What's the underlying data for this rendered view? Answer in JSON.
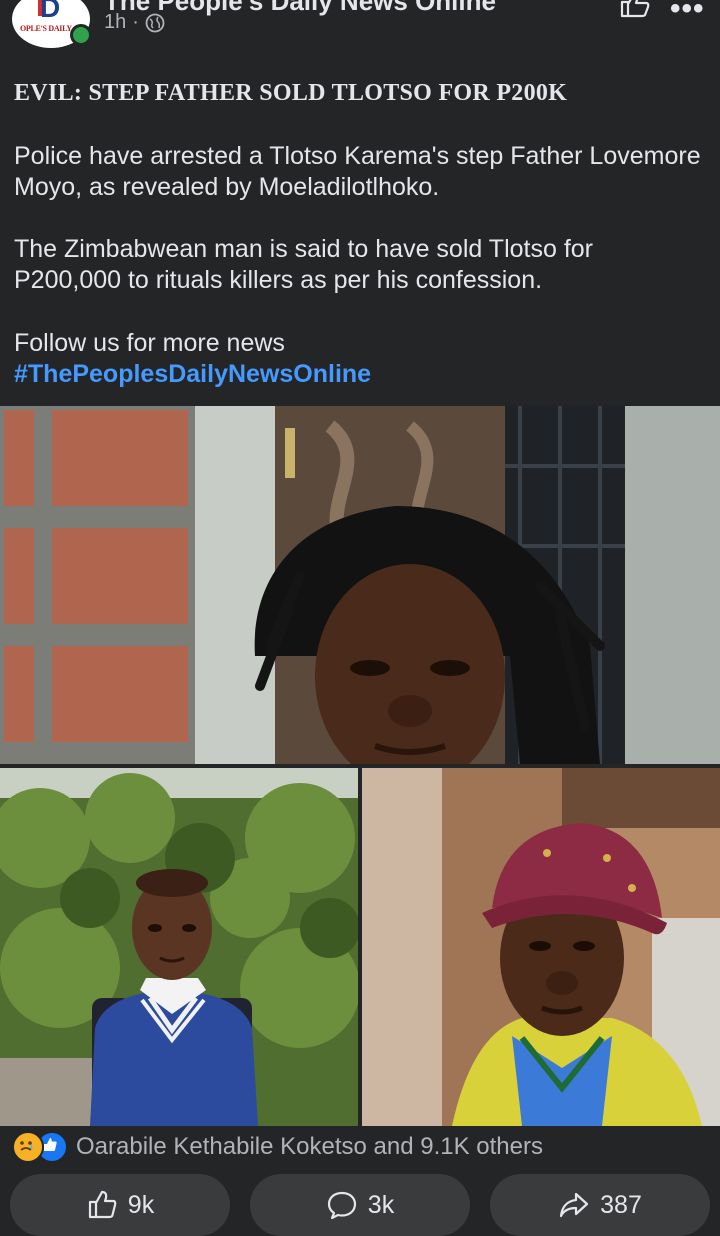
{
  "header": {
    "page_name": "The People's Daily News Online",
    "time": "1h",
    "dot": "·",
    "avatar_logo_letter": "D",
    "avatar_logo_text": "OPLE'S DAILY"
  },
  "post": {
    "headline": "EVIL: STEP FATHER SOLD TLOTSO FOR P200K",
    "paragraph1": "Police have arrested a Tlotso Karema's step Father Lovemore Moyo, as revealed by Moeladilotlhoko.",
    "paragraph2": "The Zimbabwean man is said to have sold Tlotso for P200,000 to rituals killers as per his confession.",
    "paragraph3": "Follow us for more news",
    "hashtag": "#ThePeoplesDailyNewsOnline"
  },
  "reactions": {
    "text": "Oarabile Kethabile Koketso and 9.1K others",
    "icons": [
      "sad-icon",
      "like-icon"
    ]
  },
  "actions": {
    "like_count": "9k",
    "comment_count": "3k",
    "share_count": "387"
  },
  "colors": {
    "background": "#242526",
    "text": "#e4e6eb",
    "secondary_text": "#b0b3b8",
    "link": "#4599ff",
    "button_bg": "#3a3b3c",
    "online": "#31a24c"
  }
}
